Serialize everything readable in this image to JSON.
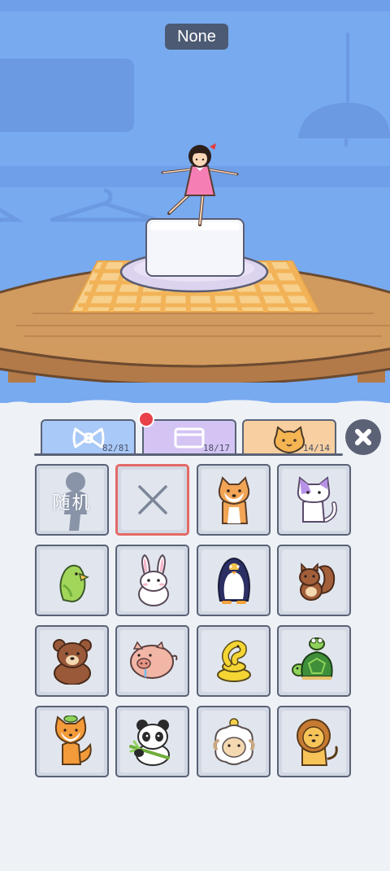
{
  "scene": {
    "label": "None"
  },
  "tabs": [
    {
      "id": "bow",
      "icon": "bow-icon",
      "count": "82/81",
      "color": "#a9c9f8"
    },
    {
      "id": "box",
      "icon": "box-icon",
      "count": "18/17",
      "color": "#d4c4f3",
      "has_badge": true
    },
    {
      "id": "cat",
      "icon": "cat-face-icon",
      "count": "14/14",
      "color": "#f7cfa0",
      "selected": true
    }
  ],
  "grid": {
    "random_label": "随机",
    "items": [
      "random-silhouette",
      "none",
      "shiba-dog",
      "purple-cat",
      "green-parrot",
      "white-rabbit",
      "penguin",
      "squirrel",
      "brown-bear",
      "pig",
      "yellow-snake",
      "turtle-with-frog",
      "fox",
      "panda",
      "sheep-with-chick",
      "lion"
    ]
  },
  "colors": {
    "sky": "#78aaf0",
    "panel": "#eef1f6",
    "selected_border": "#e36a66",
    "badge": "#e8414a"
  }
}
